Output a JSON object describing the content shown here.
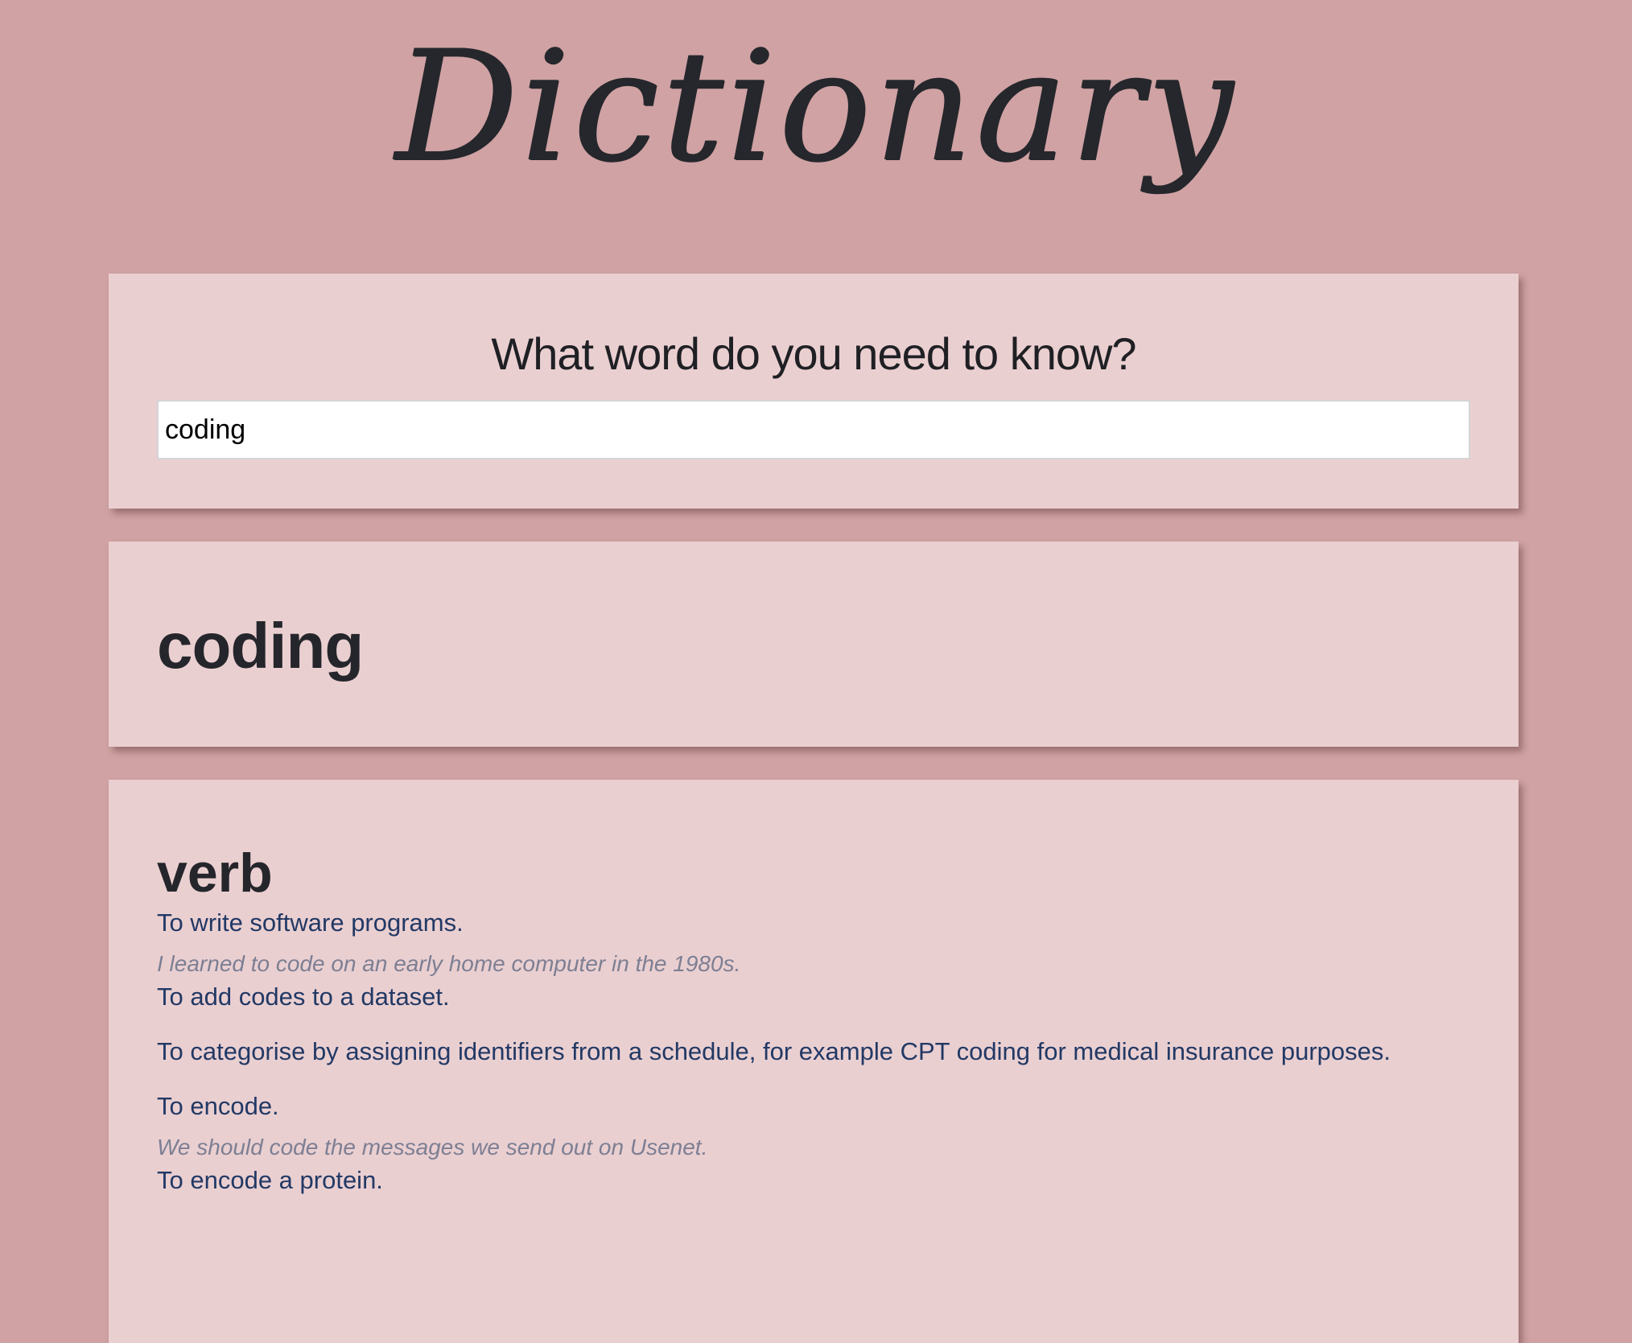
{
  "header": {
    "brand": "Dictionary"
  },
  "search": {
    "title": "What word do you need to know?",
    "value": "coding"
  },
  "result": {
    "word": "coding",
    "meanings": [
      {
        "part_of_speech": "verb",
        "definitions": [
          {
            "definition": "To write software programs.",
            "example": "I learned to code on an early home computer in the 1980s."
          },
          {
            "definition": "To add codes to a dataset."
          },
          {
            "definition": "To categorise by assigning identifiers from a schedule, for example CPT coding for medical insurance purposes."
          },
          {
            "definition": "To encode.",
            "example": "We should code the messages we send out on Usenet."
          },
          {
            "definition": "To encode a protein."
          }
        ]
      }
    ]
  },
  "colors": {
    "page_background": "#d0a2a3",
    "card_background": "#eacfd1",
    "definition_text": "#223965",
    "example_text": "#7d7f93",
    "heading_text": "#25262b"
  }
}
